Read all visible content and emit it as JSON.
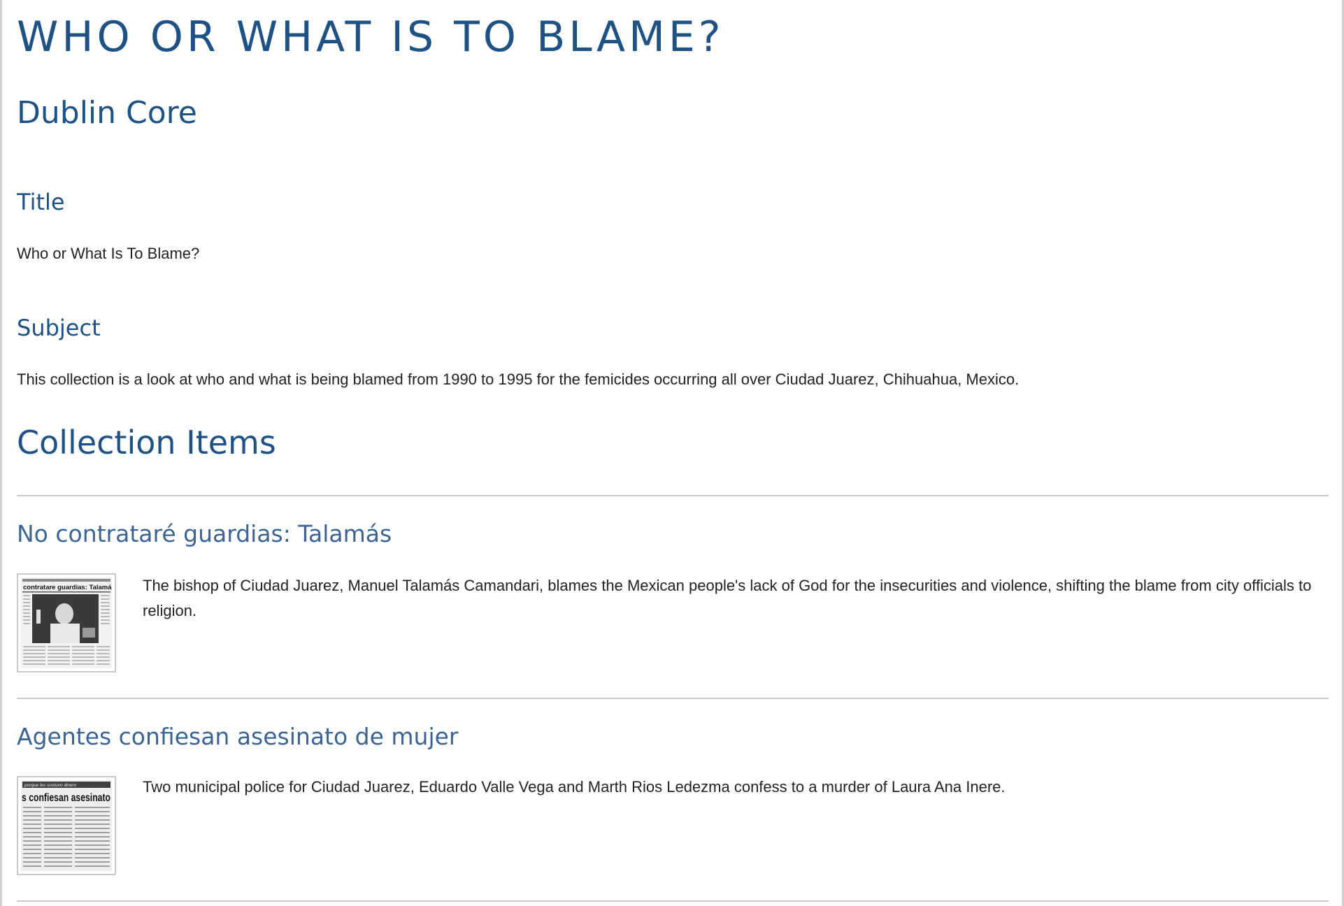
{
  "page": {
    "title": "WHO OR WHAT IS TO BLAME?"
  },
  "metadata": {
    "heading": "Dublin Core",
    "fields": [
      {
        "label": "Title",
        "value": "Who or What Is To Blame?"
      },
      {
        "label": "Subject",
        "value": "This collection is a look at who and what is being blamed from 1990 to 1995 for the femicides occurring all over Ciudad Juarez, Chihuahua, Mexico."
      }
    ]
  },
  "collection": {
    "heading": "Collection Items",
    "items": [
      {
        "title": "No contrataré guardias: Talamás",
        "description": "The bishop of Ciudad Juarez, Manuel Talamás Camandari, blames the Mexican people's lack of God for the insecurities and violence, shifting the blame from city officials to religion.",
        "thumbnail_headline": "contratare guardias: Talamás",
        "thumbnail_icon": "newspaper-clipping-photo-icon"
      },
      {
        "title": "Agentes confiesan asesinato de mujer",
        "description": "Two municipal police for Ciudad Juarez, Eduardo Valle Vega and Marth Rios Ledezma confess to a murder of Laura Ana Inere.",
        "thumbnail_kicker": "porque les sostuvo dinero",
        "thumbnail_headline": "s confiesan asesinato",
        "thumbnail_icon": "newspaper-clipping-text-icon"
      }
    ]
  },
  "colors": {
    "heading": "#1f5284",
    "item_link": "#3b6494",
    "body_text": "#222222",
    "divider": "#c9c9c9"
  }
}
